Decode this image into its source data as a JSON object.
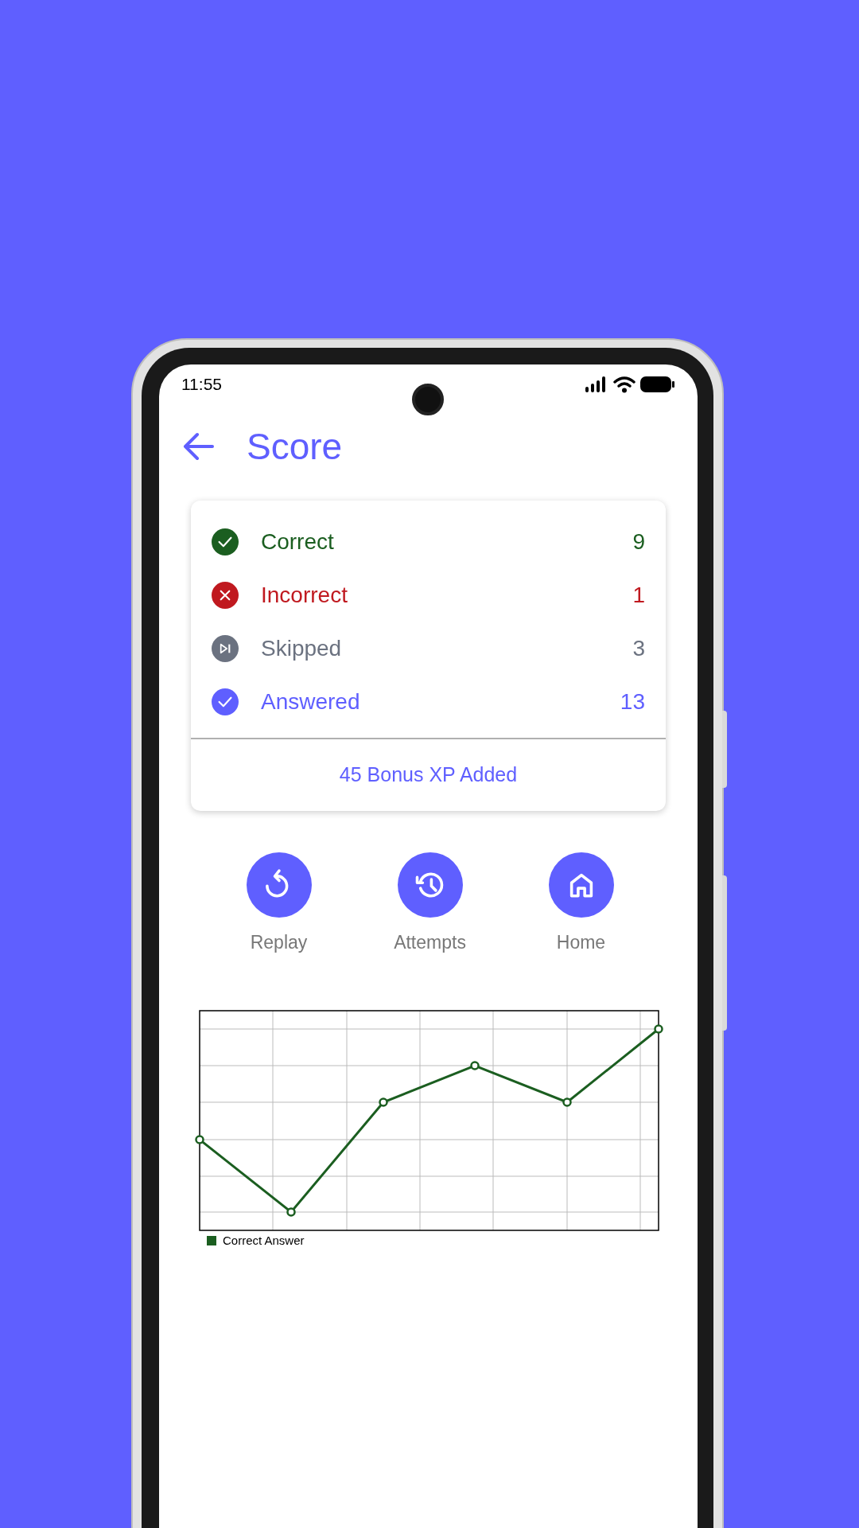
{
  "status_bar": {
    "time": "11:55"
  },
  "header": {
    "title": "Score"
  },
  "summary": [
    {
      "kind": "correct",
      "label": "Correct",
      "value": "9",
      "color": "#1b5e20"
    },
    {
      "kind": "incorrect",
      "label": "Incorrect",
      "value": "1",
      "color": "#c0191f"
    },
    {
      "kind": "skipped",
      "label": "Skipped",
      "value": "3",
      "color": "#6b7280"
    },
    {
      "kind": "answered",
      "label": "Answered",
      "value": "13",
      "color": "#5f5fff"
    }
  ],
  "bonus": "45 Bonus XP Added",
  "actions": [
    {
      "kind": "replay",
      "label": "Replay"
    },
    {
      "kind": "attempts",
      "label": "Attempts"
    },
    {
      "kind": "home",
      "label": "Home"
    }
  ],
  "chart": {
    "legend": "Correct Answer"
  }
}
